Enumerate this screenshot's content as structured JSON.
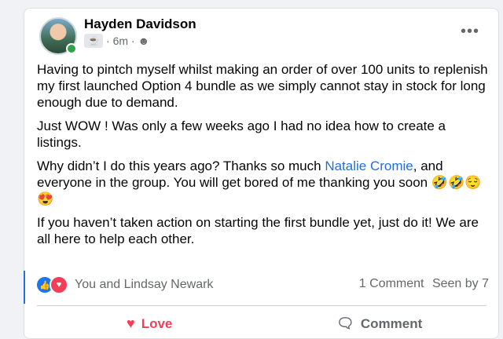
{
  "author": {
    "name": "Hayden Davidson",
    "time": "6m"
  },
  "post": {
    "p1": "Having to pintch myself whilst making an order of over 100 units to replenish my first launched Option 4 bundle as we simply cannot stay in stock for long enough due to demand.",
    "p2": "Just WOW ! Was only a few weeks ago I had no idea how to create a listings.",
    "p3_before": "Why didn’t I do this years ago? Thanks so much ",
    "p3_link": "Natalie Cromie",
    "p3_after": ", and everyone in the group. You will get bored of me thanking you soon 🤣🤣😌😍",
    "p4": "If you haven’t taken action on starting the first bundle yet, just do it! We are all here to help each other."
  },
  "reactions": {
    "text": "You and Lindsay Newark"
  },
  "stats": {
    "comments": "1 Comment",
    "seen": "Seen by 7"
  },
  "actions": {
    "love": "Love",
    "comment": "Comment"
  },
  "colors": {
    "link": "#216fdb",
    "love": "#f33e58",
    "like": "#1877f2",
    "online": "#31a24c"
  }
}
